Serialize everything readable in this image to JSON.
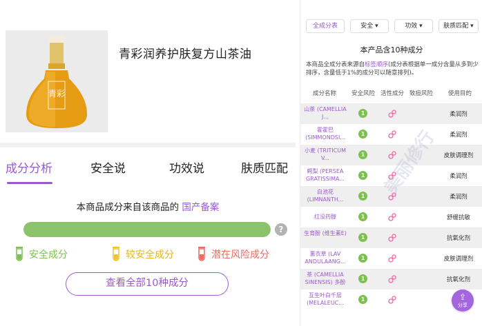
{
  "product": {
    "title": "青彩润养护肤复方山茶油",
    "image_label": "青彩"
  },
  "tabs": [
    {
      "label": "成分分析",
      "active": true
    },
    {
      "label": "安全说",
      "active": false
    },
    {
      "label": "功效说",
      "active": false
    },
    {
      "label": "肤质匹配",
      "active": false
    }
  ],
  "source": {
    "prefix": "本商品成分来自该商品的",
    "link": "国产备案"
  },
  "safety_bar": {
    "safe_fraction": 1.0,
    "help": "?"
  },
  "legend": [
    {
      "label": "安全成分",
      "color": "#7cc04f"
    },
    {
      "label": "较安全成分",
      "color": "#f2c22e"
    },
    {
      "label": "潜在风险成分",
      "color": "#ee6a63"
    }
  ],
  "view_all_button": "查看全部10种成分",
  "right": {
    "filters": [
      {
        "label": "全成分表",
        "active": true
      },
      {
        "label": "安全 ▾",
        "active": false
      },
      {
        "label": "功效 ▾",
        "active": false
      },
      {
        "label": "肤质匹配 ▾",
        "active": false
      }
    ],
    "count_title": "本产品含10种成分",
    "desc_prefix": "本商品全成分表来源自",
    "desc_link": "标签顺序",
    "desc_suffix": "(成分表根据单一成分含量从多到少排序，含量低于1%的成分可以随意排列)。",
    "columns": [
      "成分名称",
      "安全风险",
      "活性成分",
      "致痘风险",
      "使用目的"
    ],
    "ingredients": [
      {
        "name": "山茶 (CAMELLIA J...",
        "safety": "1",
        "active": true,
        "purpose": "柔润剂"
      },
      {
        "name": "霍霍巴 (SIMMONDSI...",
        "safety": "1",
        "active": true,
        "purpose": "柔润剂"
      },
      {
        "name": "小麦 (TRITICUM V...",
        "safety": "1",
        "active": true,
        "purpose": "皮肤调理剂"
      },
      {
        "name": "鳄梨 (PERSEA GRATISSIMA...",
        "safety": "1",
        "active": true,
        "purpose": "柔润剂"
      },
      {
        "name": "白池花 (LIMNANTH...",
        "safety": "1",
        "active": true,
        "purpose": "柔润剂"
      },
      {
        "name": "红没药醇",
        "safety": "1",
        "active": true,
        "purpose": "舒缓抗敏"
      },
      {
        "name": "生育酚 (维生素E)",
        "safety": "1",
        "active": true,
        "purpose": "抗氧化剂"
      },
      {
        "name": "薰衣草 (LAV ANDULAANG...",
        "safety": "1",
        "active": true,
        "purpose": "皮肤调理剂"
      },
      {
        "name": "茶 (CAMELLIA SINENSIS) 多酚",
        "safety": "1",
        "active": true,
        "purpose": "抗氧化剂"
      },
      {
        "name": "互生叶白千层 (MELALEUC...",
        "safety": "1",
        "active": true,
        "purpose": "皮"
      }
    ],
    "share_label": "分享",
    "watermark": "美丽修行"
  }
}
